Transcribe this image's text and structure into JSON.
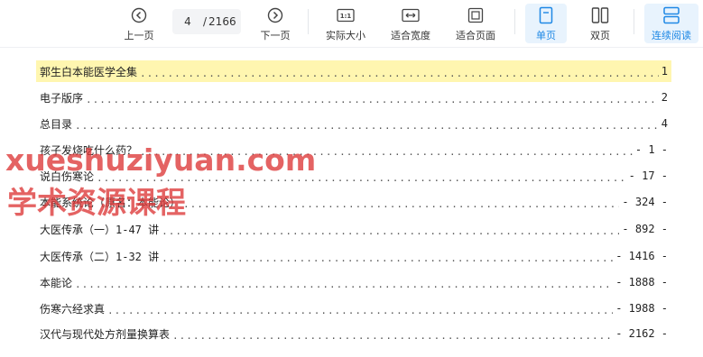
{
  "toolbar": {
    "prev_label": "上一页",
    "next_label": "下一页",
    "page_current": "4",
    "page_total": "2166",
    "page_sep": "/",
    "actual_size_label": "实际大小",
    "fit_width_label": "适合宽度",
    "fit_page_label": "适合页面",
    "single_page_label": "单页",
    "double_page_label": "双页",
    "continuous_label": "连续阅读",
    "active_color": "#1e88e5"
  },
  "toc": [
    {
      "title": "郭生白本能医学全集",
      "page": "1"
    },
    {
      "title": "电子版序",
      "page": "2"
    },
    {
      "title": "总目录",
      "page": "4"
    },
    {
      "title": "孩子发烧吃什么药？",
      "page": "- 1 -"
    },
    {
      "title": "说白伤寒论",
      "page": "- 17 -"
    },
    {
      "title": "本能系统论（原名：本能论）",
      "page": "- 324 -"
    },
    {
      "title": "大医传承（一）1-47 讲",
      "page": "- 892 -"
    },
    {
      "title": "大医传承（二）1-32 讲",
      "page": "- 1416 -"
    },
    {
      "title": "本能论",
      "page": "- 1888 -"
    },
    {
      "title": "伤寒六经求真",
      "page": "- 1988 -"
    },
    {
      "title": "汉代与现代处方剂量换算表",
      "page": "- 2162 -"
    }
  ],
  "watermark": {
    "line1": "xueshuziyuan.com",
    "line2": "学术资源课程"
  }
}
